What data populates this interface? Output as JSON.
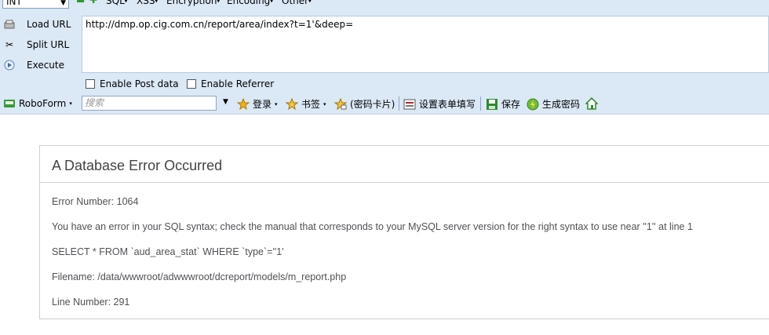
{
  "hackbar": {
    "select_value": "INT",
    "menus": [
      "SQL",
      "XSS",
      "Encryption",
      "Encoding",
      "Other"
    ],
    "load_url": "Load URL",
    "split_url": "Split URL",
    "execute": "Execute",
    "url": "http://dmp.op.cig.com.cn/report/area/index?t=1'&deep=",
    "enable_post": "Enable Post data",
    "enable_referrer": "Enable Referrer"
  },
  "roboform": {
    "label": "RoboForm",
    "search_placeholder": "搜索",
    "login": "登录",
    "bookmarks": "书签",
    "password_cards": "(密码卡片)",
    "fill_forms": "设置表单填写",
    "save": "保存",
    "generate_password": "生成密码"
  },
  "error": {
    "title": "A Database Error Occurred",
    "number": "Error Number: 1064",
    "message": "You have an error in your SQL syntax; check the manual that corresponds to your MySQL server version for the right syntax to use near ''1'' at line 1",
    "query": "SELECT * FROM `aud_area_stat` WHERE `type`=''1'",
    "filename": "Filename: /data/wwwroot/adwwwroot/dcreport/models/m_report.php",
    "line": "Line Number: 291"
  }
}
